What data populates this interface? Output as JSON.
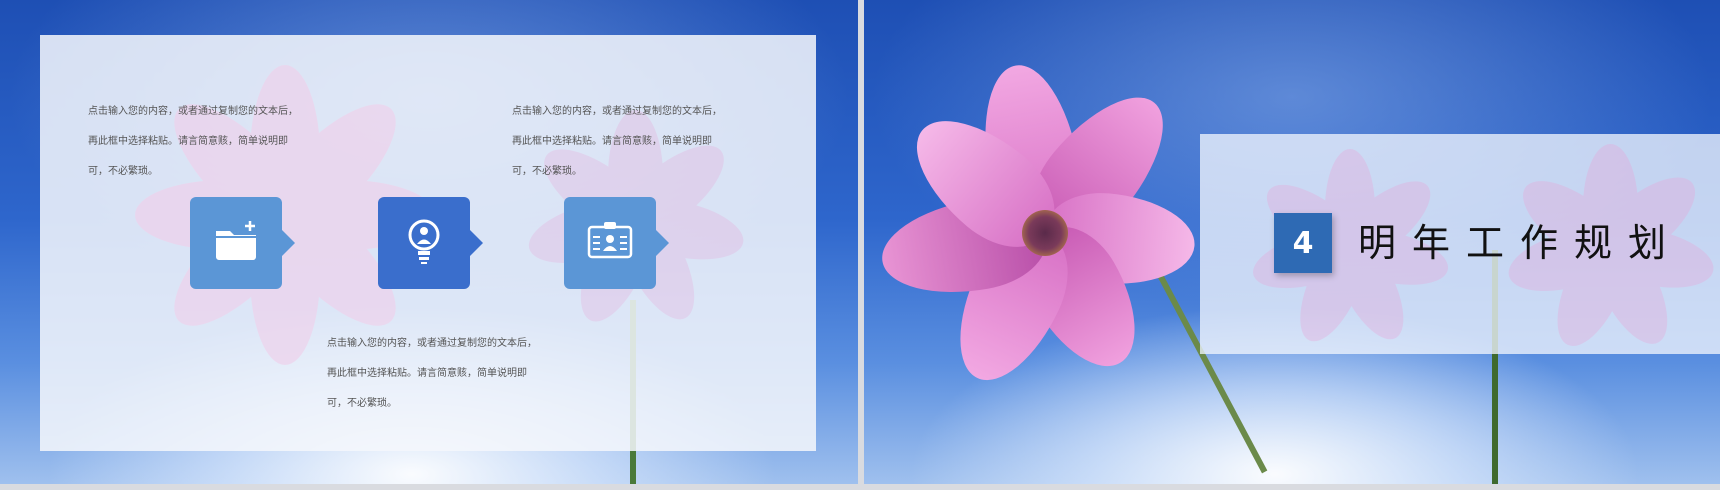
{
  "left_slide": {
    "captions": [
      "点击输入您的内容，或者通过复制您的文本后，再此框中选择粘贴。请言简意赅，简单说明即可，不必繁琐。",
      "点击输入您的内容，或者通过复制您的文本后，再此框中选择粘贴。请言简意赅，简单说明即可，不必繁琐。",
      "点击输入您的内容，或者通过复制您的文本后，再此框中选择粘贴。请言简意赅，简单说明即可，不必繁琐。"
    ],
    "icons": [
      "folder-add-icon",
      "lightbulb-icon",
      "id-card-icon"
    ],
    "colors": {
      "tile_light": "#5b96d6",
      "tile_dark": "#3a6ecc"
    }
  },
  "right_slide": {
    "section_number": "4",
    "section_title": "明年工作规划",
    "colors": {
      "number_box": "#2e6ab4"
    }
  }
}
